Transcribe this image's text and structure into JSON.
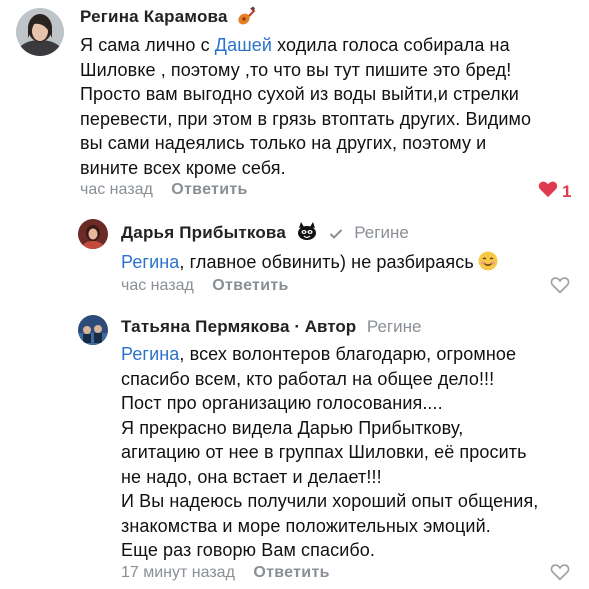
{
  "comments": [
    {
      "author": "Регина Карамова",
      "text_lines": [
        [
          {
            "t": "Я сама лично с "
          },
          {
            "t": "Дашей",
            "mention": true
          },
          {
            "t": "  ходила  голоса собирала на"
          }
        ],
        [
          {
            "t": "Шиловке , поэтому ,то что вы тут пишите это бред!"
          }
        ],
        [
          {
            "t": "Просто вам выгодно сухой из воды выйти,и стрелки"
          }
        ],
        [
          {
            "t": "перевести, при этом в грязь втоптать других. Видимо"
          }
        ],
        [
          {
            "t": "вы сами надеялись только на других, поэтому и"
          }
        ],
        [
          {
            "t": "вините всех кроме себя."
          }
        ]
      ],
      "time": "час назад",
      "reply_label": "Ответить",
      "likes": "1",
      "liked": true,
      "badge_icon": "guitar-icon"
    },
    {
      "author": "Дарья Прибыткова",
      "reply_to": "Регине",
      "badge_icon": "cat-sticker-icon",
      "text_lines": [
        [
          {
            "t": "Регина",
            "mention": true
          },
          {
            "t": ", главное обвинить) не разбираясь"
          }
        ]
      ],
      "emoji_icon": "smiling-face-icon",
      "time": "час назад",
      "reply_label": "Ответить",
      "liked": false
    },
    {
      "author": "Татьяна Пермякова",
      "author_tag": " · Автор",
      "reply_to": "Регине",
      "text_lines": [
        [
          {
            "t": "Регина",
            "mention": true
          },
          {
            "t": ", всех волонтеров благодарю, огромное"
          }
        ],
        [
          {
            "t": "спасибо всем, кто работал на общее дело!!!"
          }
        ],
        [
          {
            "t": "Пост про организацию голосования...."
          }
        ],
        [
          {
            "t": "Я прекрасно видела Дарью Прибыткову,"
          }
        ],
        [
          {
            "t": "агитацию от нее в группах Шиловки, её просить"
          }
        ],
        [
          {
            "t": "не надо, она встает и делает!!!"
          }
        ],
        [
          {
            "t": "И Вы надеюсь получили хороший опыт общения,"
          }
        ],
        [
          {
            "t": "знакомства и море положительных эмоций."
          }
        ],
        [
          {
            "t": "Еще раз говорю Вам спасибо."
          }
        ]
      ],
      "time": "17 минут назад",
      "reply_label": "Ответить",
      "liked": false
    }
  ],
  "colors": {
    "mention": "#2a73cc",
    "muted": "#8a8f96",
    "like_active": "#e03a4e"
  }
}
